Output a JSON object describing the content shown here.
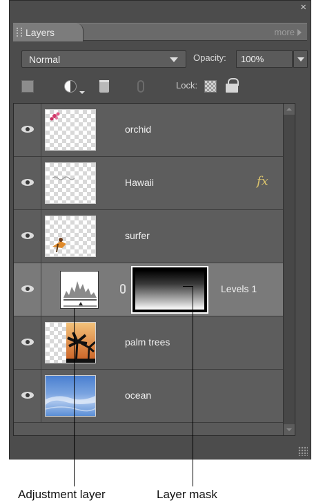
{
  "panel": {
    "close_label": "×",
    "tab_label": "Layers",
    "more_label": "more",
    "blend_mode": "Normal",
    "opacity_label": "Opacity:",
    "opacity_value": "100%",
    "lock_label": "Lock:"
  },
  "icons": {
    "new_layer": "new-layer-icon",
    "adjustment": "adjustment-layer-icon",
    "delete": "trash-icon",
    "link": "link-icon",
    "lock_transparent": "lock-transparent-pixels-icon",
    "lock_all": "lock-icon",
    "visibility": "eye-icon",
    "effects": "fx-icon"
  },
  "layers": [
    {
      "name": "orchid",
      "visible": true,
      "fx": false
    },
    {
      "name": "Hawaii",
      "visible": true,
      "fx": true,
      "fx_label": "fx"
    },
    {
      "name": "surfer",
      "visible": true,
      "fx": false
    },
    {
      "name": "Levels 1",
      "visible": true,
      "fx": false,
      "selected": true,
      "adjustment": true
    },
    {
      "name": "palm trees",
      "visible": true,
      "fx": false
    },
    {
      "name": "ocean",
      "visible": true,
      "fx": false
    }
  ],
  "callouts": {
    "adjustment": "Adjustment layer",
    "mask": "Layer mask"
  },
  "colors": {
    "panel_bg": "#4c4c4c",
    "selected_row": "#7a7a7a",
    "fx": "#d9c26c"
  }
}
